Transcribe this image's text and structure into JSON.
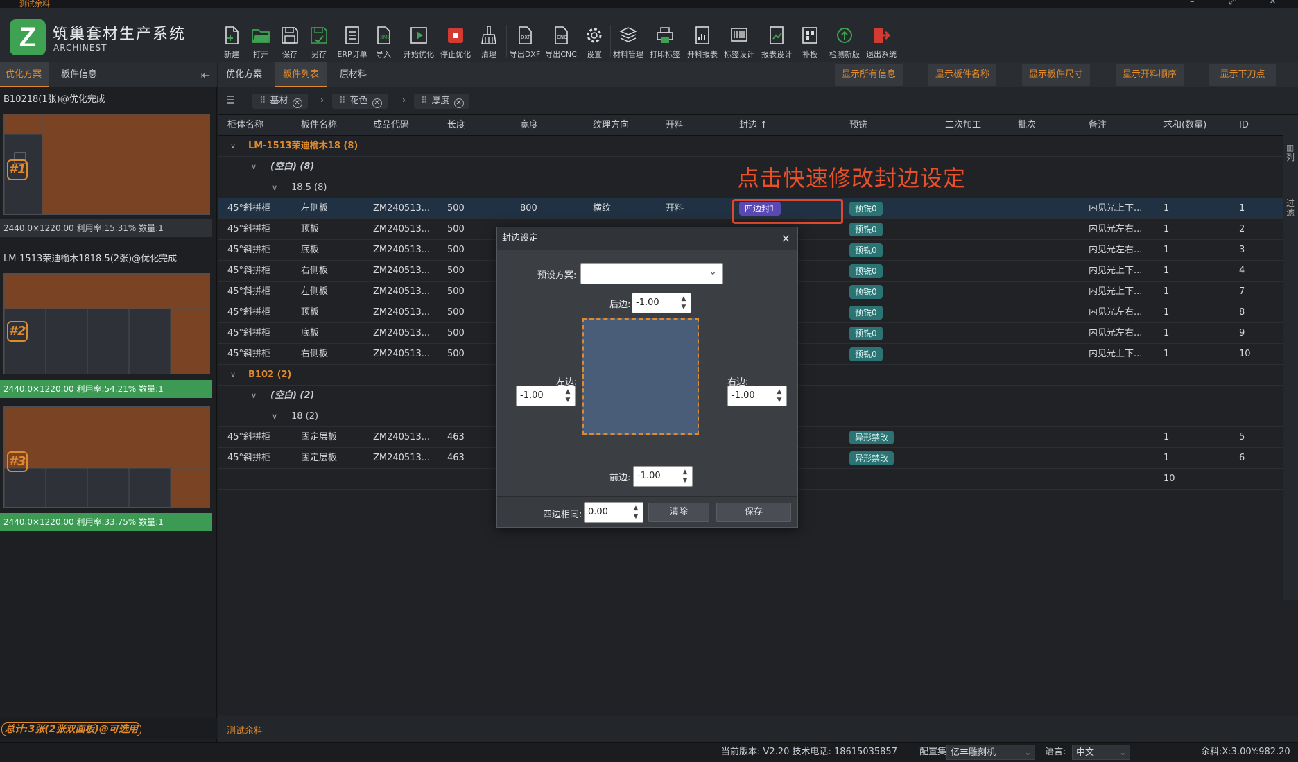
{
  "window": {
    "title": "测试余料"
  },
  "app": {
    "title": "筑巢套材生产系统",
    "subtitle": "ARCHINEST",
    "logo_letter": "Z"
  },
  "toolbar": [
    {
      "label": "新建",
      "icon": "new-file-icon"
    },
    {
      "label": "打开",
      "icon": "folder-open-icon"
    },
    {
      "label": "保存",
      "icon": "save-icon"
    },
    {
      "label": "另存",
      "icon": "save-as-icon"
    },
    {
      "label": "ERP订单",
      "icon": "erp-order-icon"
    },
    {
      "label": "导入",
      "icon": "import-xml-icon"
    },
    {
      "label": "开始优化",
      "icon": "play-icon"
    },
    {
      "label": "停止优化",
      "icon": "stop-icon"
    },
    {
      "label": "清理",
      "icon": "broom-icon"
    },
    {
      "label": "导出DXF",
      "icon": "dxf-icon"
    },
    {
      "label": "导出CNC",
      "icon": "cnc-icon"
    },
    {
      "label": "设置",
      "icon": "gear-icon"
    },
    {
      "label": "材料管理",
      "icon": "layers-icon"
    },
    {
      "label": "打印标签",
      "icon": "printer-icon"
    },
    {
      "label": "开料报表",
      "icon": "chart-report-icon"
    },
    {
      "label": "标签设计",
      "icon": "barcode-icon"
    },
    {
      "label": "报表设计",
      "icon": "report-design-icon"
    },
    {
      "label": "补板",
      "icon": "patch-board-icon"
    },
    {
      "label": "检测新版",
      "icon": "update-icon"
    },
    {
      "label": "退出系统",
      "icon": "exit-icon"
    }
  ],
  "left_panel": {
    "tabs": [
      "优化方案",
      "板件信息"
    ],
    "plans": [
      {
        "title": "B10218(1张)@优化完成",
        "badge": "#1",
        "stat": "2440.0×1220.00 利用率:15.31% 数量:1"
      },
      {
        "title": "LM-1513荣迪榆木1818.5(2张)@优化完成",
        "badge": "#2",
        "stat": "2440.0×1220.00 利用率:54.21% 数量:1"
      },
      {
        "badge": "#3",
        "stat": "2440.0×1220.00 利用率:33.75% 数量:1"
      }
    ],
    "footer": "总计:3张(2张双面板)@可选用"
  },
  "main": {
    "tabs": [
      "优化方案",
      "板件列表",
      "原材料"
    ],
    "buttons": [
      "显示所有信息",
      "显示板件名称",
      "显示板件尺寸",
      "显示开料顺序",
      "显示下刀点"
    ],
    "filters": [
      "基材",
      "花色",
      "厚度"
    ],
    "columns": [
      "柜体名称",
      "板件名称",
      "成品代码",
      "长度",
      "宽度",
      "纹理方向",
      "开料",
      "封边 ↑",
      "预铣",
      "二次加工",
      "批次",
      "备注",
      "求和(数量)",
      "ID"
    ],
    "groups": {
      "g1": "LM-1513荣迪榆木18 (8)",
      "g1a": "(空白) (8)",
      "g1b": "18.5 (8)",
      "g2": "B102 (2)",
      "g2a": "(空白) (2)",
      "g2b": "18 (2)"
    },
    "rows_a": [
      {
        "cabinet": "45°斜拼柜",
        "name": "左侧板",
        "code": "ZM240513...",
        "length": "500",
        "width": "800",
        "grain": "横纹",
        "cut": "开料",
        "edge": "四边封1",
        "mill": "预铣0",
        "note": "内见光上下...",
        "qty": "1",
        "id": "1"
      },
      {
        "cabinet": "45°斜拼柜",
        "name": "顶板",
        "code": "ZM240513...",
        "length": "500",
        "mill": "预铣0",
        "note": "内见光左右...",
        "qty": "1",
        "id": "2"
      },
      {
        "cabinet": "45°斜拼柜",
        "name": "底板",
        "code": "ZM240513...",
        "length": "500",
        "mill": "预铣0",
        "note": "内见光左右...",
        "qty": "1",
        "id": "3"
      },
      {
        "cabinet": "45°斜拼柜",
        "name": "右侧板",
        "code": "ZM240513...",
        "length": "500",
        "mill": "预铣0",
        "note": "内见光上下...",
        "qty": "1",
        "id": "4"
      },
      {
        "cabinet": "45°斜拼柜",
        "name": "左侧板",
        "code": "ZM240513...",
        "length": "500",
        "mill": "预铣0",
        "note": "内见光上下...",
        "qty": "1",
        "id": "7"
      },
      {
        "cabinet": "45°斜拼柜",
        "name": "顶板",
        "code": "ZM240513...",
        "length": "500",
        "mill": "预铣0",
        "note": "内见光左右...",
        "qty": "1",
        "id": "8"
      },
      {
        "cabinet": "45°斜拼柜",
        "name": "底板",
        "code": "ZM240513...",
        "length": "500",
        "mill": "预铣0",
        "note": "内见光左右...",
        "qty": "1",
        "id": "9"
      },
      {
        "cabinet": "45°斜拼柜",
        "name": "右侧板",
        "code": "ZM240513...",
        "length": "500",
        "mill": "预铣0",
        "note": "内见光上下...",
        "qty": "1",
        "id": "10"
      }
    ],
    "rows_b": [
      {
        "cabinet": "45°斜拼柜",
        "name": "固定层板",
        "code": "ZM240513...",
        "length": "463",
        "mill": "异形禁改",
        "qty": "1",
        "id": "5"
      },
      {
        "cabinet": "45°斜拼柜",
        "name": "固定层板",
        "code": "ZM240513...",
        "length": "463",
        "mill": "异形禁改",
        "qty": "1",
        "id": "6"
      }
    ],
    "total_qty": "10",
    "right_strip": [
      "列",
      "过滤"
    ],
    "annotation": "点击快速修改封边设定",
    "bottom_tab": "测试余料"
  },
  "dialog": {
    "title": "封边设定",
    "close": "×",
    "preset_label": "预设方案:",
    "preset_value": "",
    "back_label": "后边:",
    "back_value": "-1.00",
    "left_label": "左边:",
    "left_value": "-1.00",
    "right_label": "右边:",
    "right_value": "-1.00",
    "front_label": "前边:",
    "front_value": "-1.00",
    "same_label": "四边相同:",
    "same_value": "0.00",
    "clear_label": "清除",
    "save_label": "保存"
  },
  "statusbar": {
    "version": "当前版本: V2.20 技术电话: 18615035857",
    "config_label": "配置集:",
    "config_value": "亿丰雕刻机",
    "lang_label": "语言:",
    "lang_value": "中文",
    "coords": "余料:X:3.00Y:982.20"
  },
  "colors": {
    "accent": "#e08a2e",
    "annotation": "#e8502a",
    "success": "#3d9a55",
    "teal_tag": "#2c7373",
    "purple_tag": "#5a49b3",
    "board_wood": "#7a4323"
  }
}
